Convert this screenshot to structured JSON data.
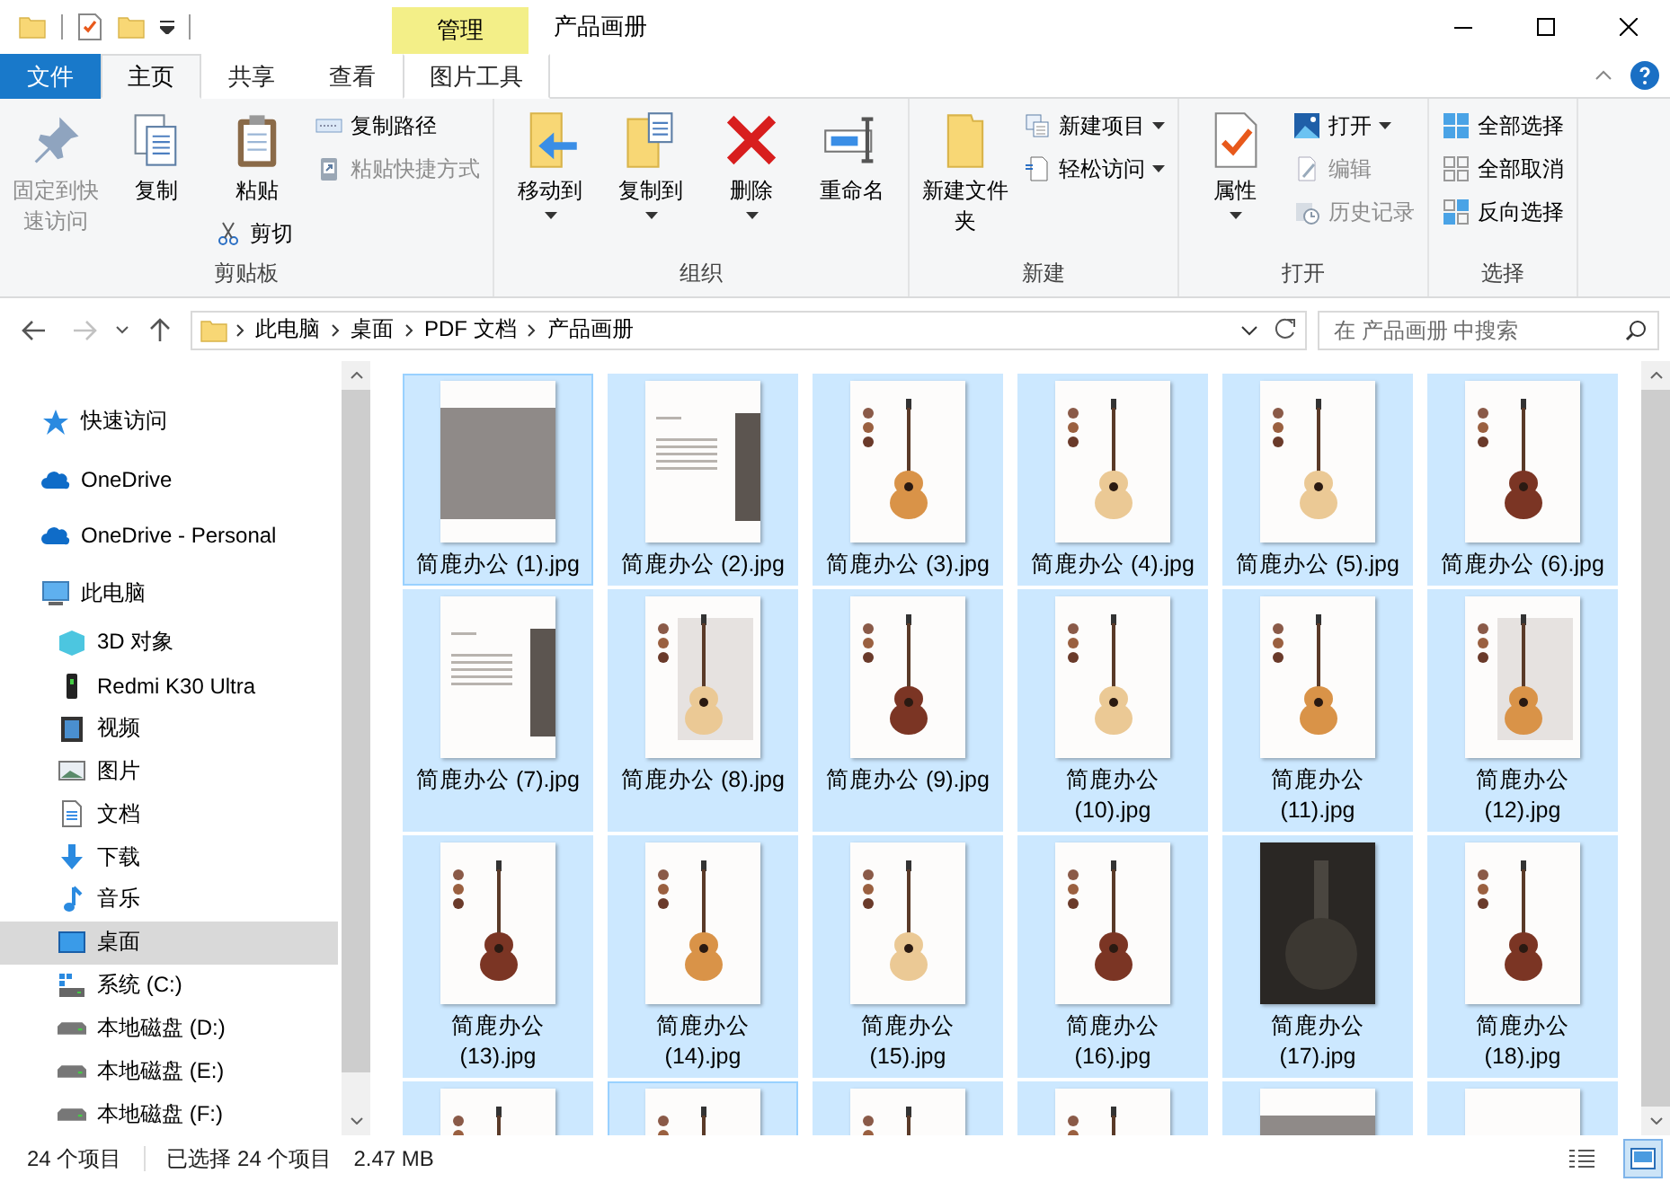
{
  "window": {
    "title": "产品画册",
    "context_header": "管理"
  },
  "ribbon_tabs": [
    {
      "label": "文件",
      "kind": "file",
      "selected": false
    },
    {
      "label": "主页",
      "kind": "normal",
      "selected": true
    },
    {
      "label": "共享",
      "kind": "normal",
      "selected": false
    },
    {
      "label": "查看",
      "kind": "normal",
      "selected": false
    },
    {
      "label": "图片工具",
      "kind": "context",
      "selected": false
    }
  ],
  "ribbon_groups": [
    {
      "label": "剪贴板",
      "columns": [
        [
          {
            "kind": "pin",
            "label": "固定到快速访问",
            "disabled": true,
            "dropdown": false
          }
        ],
        [
          {
            "kind": "copy",
            "label": "复制",
            "disabled": false,
            "dropdown": false
          }
        ],
        [
          {
            "kind": "paste",
            "label": "粘贴",
            "disabled": false,
            "dropdown": false
          },
          {
            "kind": "cut",
            "label": "剪切",
            "disabled": false,
            "dropdown": false
          }
        ],
        [
          {
            "kind": "path",
            "label": "复制路径",
            "disabled": false,
            "dropdown": false
          },
          {
            "kind": "shortcut",
            "label": "粘贴快捷方式",
            "disabled": true,
            "dropdown": false
          }
        ]
      ]
    },
    {
      "label": "组织",
      "columns": [
        [
          {
            "kind": "move",
            "label": "移动到",
            "disabled": false,
            "dropdown": true
          }
        ],
        [
          {
            "kind": "copyto",
            "label": "复制到",
            "disabled": false,
            "dropdown": true
          }
        ],
        [
          {
            "kind": "delete",
            "label": "删除",
            "disabled": false,
            "dropdown": true
          }
        ],
        [
          {
            "kind": "rename",
            "label": "重命名",
            "disabled": false,
            "dropdown": false
          }
        ]
      ]
    },
    {
      "label": "新建",
      "columns": [
        [
          {
            "kind": "folder",
            "label": "新建文件夹",
            "disabled": false,
            "dropdown": false
          }
        ],
        [
          {
            "kind": "newitem",
            "label": "新建项目",
            "disabled": false,
            "dropdown": true
          },
          {
            "kind": "easy",
            "label": "轻松访问",
            "disabled": false,
            "dropdown": true
          }
        ]
      ]
    },
    {
      "label": "打开",
      "columns": [
        [
          {
            "kind": "props",
            "label": "属性",
            "disabled": false,
            "dropdown": true
          }
        ],
        [
          {
            "kind": "open",
            "label": "打开",
            "disabled": false,
            "dropdown": true
          },
          {
            "kind": "edit",
            "label": "编辑",
            "disabled": true,
            "dropdown": false
          },
          {
            "kind": "history",
            "label": "历史记录",
            "disabled": true,
            "dropdown": false
          }
        ]
      ]
    },
    {
      "label": "选择",
      "columns": [
        [
          {
            "kind": "all",
            "label": "全部选择",
            "disabled": false,
            "dropdown": false
          },
          {
            "kind": "none",
            "label": "全部取消",
            "disabled": false,
            "dropdown": false
          },
          {
            "kind": "invert",
            "label": "反向选择",
            "disabled": false,
            "dropdown": false
          }
        ]
      ]
    }
  ],
  "navigation": {
    "back_disabled": false,
    "forward_disabled": true
  },
  "breadcrumbs": [
    "此电脑",
    "桌面",
    "PDF 文档",
    "产品画册"
  ],
  "search": {
    "placeholder": "在 产品画册 中搜索"
  },
  "sidebar": {
    "items": [
      {
        "kind": "star",
        "label": "快速访问",
        "selected": false
      },
      {
        "kind": "cloud",
        "label": "OneDrive",
        "selected": false
      },
      {
        "kind": "cloud",
        "label": "OneDrive - Personal",
        "selected": false
      },
      {
        "kind": "pc",
        "label": "此电脑",
        "selected": false,
        "children": [
          {
            "kind": "cube",
            "label": "3D 对象",
            "selected": false
          },
          {
            "kind": "phone",
            "label": "Redmi K30 Ultra",
            "selected": false
          },
          {
            "kind": "video",
            "label": "视频",
            "selected": false
          },
          {
            "kind": "picture",
            "label": "图片",
            "selected": false
          },
          {
            "kind": "document",
            "label": "文档",
            "selected": false
          },
          {
            "kind": "download",
            "label": "下载",
            "selected": false
          },
          {
            "kind": "music",
            "label": "音乐",
            "selected": false
          },
          {
            "kind": "desktop",
            "label": "桌面",
            "selected": true
          },
          {
            "kind": "system",
            "label": "系统 (C:)",
            "selected": false
          },
          {
            "kind": "drive",
            "label": "本地磁盘 (D:)",
            "selected": false
          },
          {
            "kind": "drive",
            "label": "本地磁盘 (E:)",
            "selected": false
          },
          {
            "kind": "drive",
            "label": "本地磁盘 (F:)",
            "selected": false
          }
        ]
      }
    ]
  },
  "files": [
    {
      "name": "简鹿办公 (1).jpg",
      "kind": "photo",
      "selected": true,
      "focused": true
    },
    {
      "name": "简鹿办公 (2).jpg",
      "kind": "text",
      "selected": true,
      "focused": false
    },
    {
      "name": "简鹿办公 (3).jpg",
      "kind": "guitar",
      "color": "#d99348",
      "selected": true,
      "focused": false
    },
    {
      "name": "简鹿办公 (4).jpg",
      "kind": "guitar",
      "color": "#ebc995",
      "selected": true,
      "focused": false
    },
    {
      "name": "简鹿办公 (5).jpg",
      "kind": "guitar",
      "color": "#ebc995",
      "selected": true,
      "focused": false
    },
    {
      "name": "简鹿办公 (6).jpg",
      "kind": "guitar",
      "color": "#7b3524",
      "selected": true,
      "focused": false
    },
    {
      "name": "简鹿办公 (7).jpg",
      "kind": "text",
      "selected": true,
      "focused": false
    },
    {
      "name": "简鹿办公 (8).jpg",
      "kind": "studio",
      "color": "#ebc995",
      "selected": true,
      "focused": false
    },
    {
      "name": "简鹿办公 (9).jpg",
      "kind": "guitar",
      "color": "#7b3524",
      "selected": true,
      "focused": false
    },
    {
      "name": "简鹿办公 (10).jpg",
      "kind": "guitar",
      "color": "#ebc995",
      "selected": true,
      "focused": false
    },
    {
      "name": "简鹿办公 (11).jpg",
      "kind": "guitar",
      "color": "#d99348",
      "selected": true,
      "focused": false
    },
    {
      "name": "简鹿办公 (12).jpg",
      "kind": "studio",
      "color": "#d99348",
      "selected": true,
      "focused": false
    },
    {
      "name": "简鹿办公 (13).jpg",
      "kind": "guitar",
      "color": "#7b3524",
      "selected": true,
      "focused": false
    },
    {
      "name": "简鹿办公 (14).jpg",
      "kind": "guitar",
      "color": "#d99348",
      "selected": true,
      "focused": false
    },
    {
      "name": "简鹿办公 (15).jpg",
      "kind": "guitar",
      "color": "#ebc995",
      "selected": true,
      "focused": false
    },
    {
      "name": "简鹿办公 (16).jpg",
      "kind": "guitar",
      "color": "#7b3524",
      "selected": true,
      "focused": false
    },
    {
      "name": "简鹿办公 (17).jpg",
      "kind": "dark",
      "selected": true,
      "focused": false
    },
    {
      "name": "简鹿办公 (18).jpg",
      "kind": "guitar",
      "color": "#7b3524",
      "selected": true,
      "focused": false
    },
    {
      "kind": "guitar",
      "selected": true,
      "focused": false
    },
    {
      "kind": "guitar",
      "selected": true,
      "focused": true
    },
    {
      "kind": "guitar",
      "selected": true,
      "focused": false
    },
    {
      "kind": "guitar",
      "selected": true,
      "focused": false
    },
    {
      "kind": "photo",
      "selected": true,
      "focused": false
    },
    {
      "kind": "catalog",
      "selected": true,
      "focused": false
    }
  ],
  "status_bar": {
    "item_count": "24 个项目",
    "selection": "已选择 24 个项目",
    "size": "2.47 MB"
  },
  "view_buttons": [
    {
      "kind": "details",
      "selected": false
    },
    {
      "kind": "thumbnails",
      "selected": true
    }
  ]
}
